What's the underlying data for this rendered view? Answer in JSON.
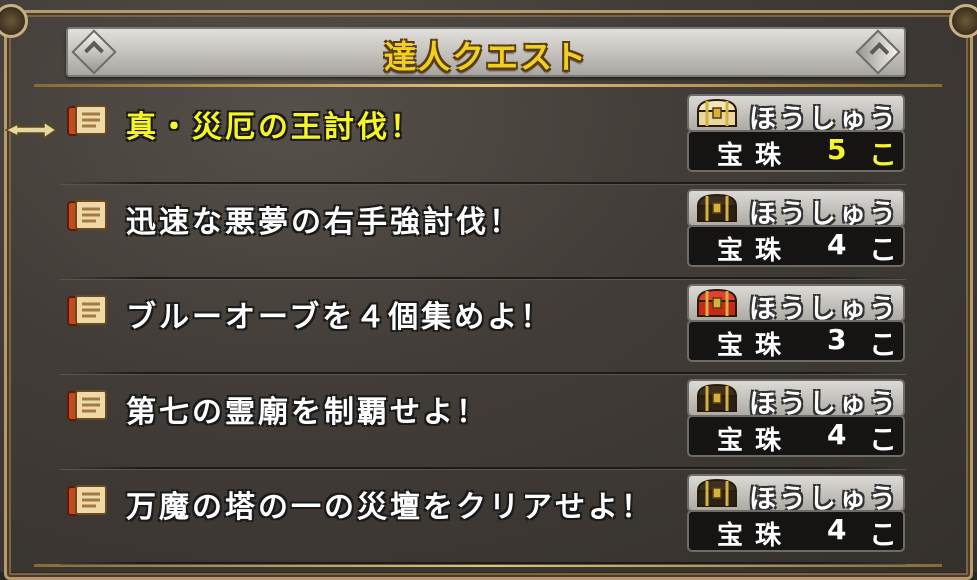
{
  "header": {
    "title": "達人クエスト"
  },
  "colors": {
    "selected_text": "#f5f52a",
    "normal_text": "#ffffff",
    "title_text": "#f0d020"
  },
  "quests": [
    {
      "title": "真・災厄の王討伐！",
      "reward_label": "ほうしゅう",
      "reward_item": "宝珠",
      "reward_count": "5",
      "reward_unit": "こ",
      "chest": "gold-chest-icon",
      "selected": true
    },
    {
      "title": "迅速な悪夢の右手強討伐！",
      "reward_label": "ほうしゅう",
      "reward_item": "宝珠",
      "reward_count": "4",
      "reward_unit": "こ",
      "chest": "black-chest-icon",
      "selected": false
    },
    {
      "title": "ブルーオーブを４個集めよ！",
      "reward_label": "ほうしゅう",
      "reward_item": "宝珠",
      "reward_count": "3",
      "reward_unit": "こ",
      "chest": "red-chest-icon",
      "selected": false
    },
    {
      "title": "第七の霊廟を制覇せよ！",
      "reward_label": "ほうしゅう",
      "reward_item": "宝珠",
      "reward_count": "4",
      "reward_unit": "こ",
      "chest": "black-chest-icon",
      "selected": false
    },
    {
      "title": "万魔の塔の一の災壇をクリアせよ！",
      "reward_label": "ほうしゅう",
      "reward_item": "宝珠",
      "reward_count": "4",
      "reward_unit": "こ",
      "chest": "black-chest-icon",
      "selected": false
    }
  ]
}
